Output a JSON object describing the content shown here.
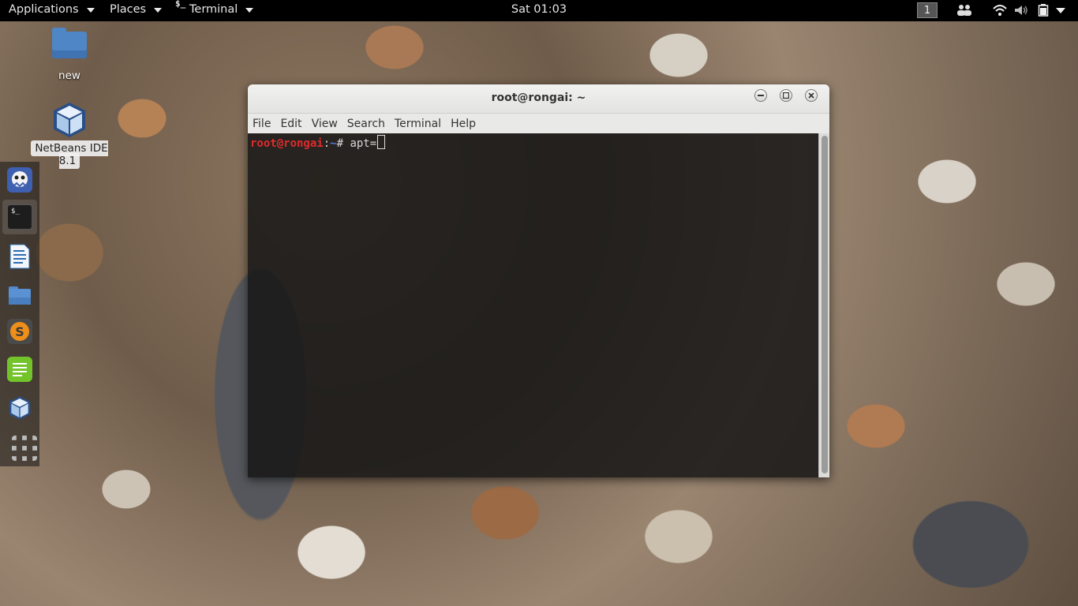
{
  "top_panel": {
    "applications": "Applications",
    "places": "Places",
    "terminal_glyph": "$_",
    "terminal": "Terminal",
    "clock": "Sat 01:03",
    "workspace": "1",
    "tray_icons": [
      "people-icon",
      "wifi-icon",
      "volume-icon",
      "battery-icon",
      "system-menu-caret-icon"
    ]
  },
  "desktop": {
    "icons": [
      {
        "label": "new",
        "icon": "folder-icon"
      },
      {
        "label": "NetBeans IDE 8.1",
        "icon": "netbeans-cube-icon"
      }
    ]
  },
  "dock": {
    "items": [
      "maltego-icon",
      "terminal-icon",
      "libreoffice-writer-icon",
      "files-icon",
      "sublime-text-icon",
      "text-editor-icon",
      "netbeans-icon",
      "show-applications-icon"
    ]
  },
  "window": {
    "title": "root@rongai: ~",
    "menu": [
      "File",
      "Edit",
      "View",
      "Search",
      "Terminal",
      "Help"
    ],
    "terminal": {
      "user_host": "root@rongai",
      "separator": ":",
      "path": "~",
      "prompt_symbol": "# ",
      "command": "apt="
    }
  },
  "colors": {
    "prompt_user": "#e02b2b",
    "prompt_path": "#5b79d8",
    "panel_bg": "#000000"
  }
}
